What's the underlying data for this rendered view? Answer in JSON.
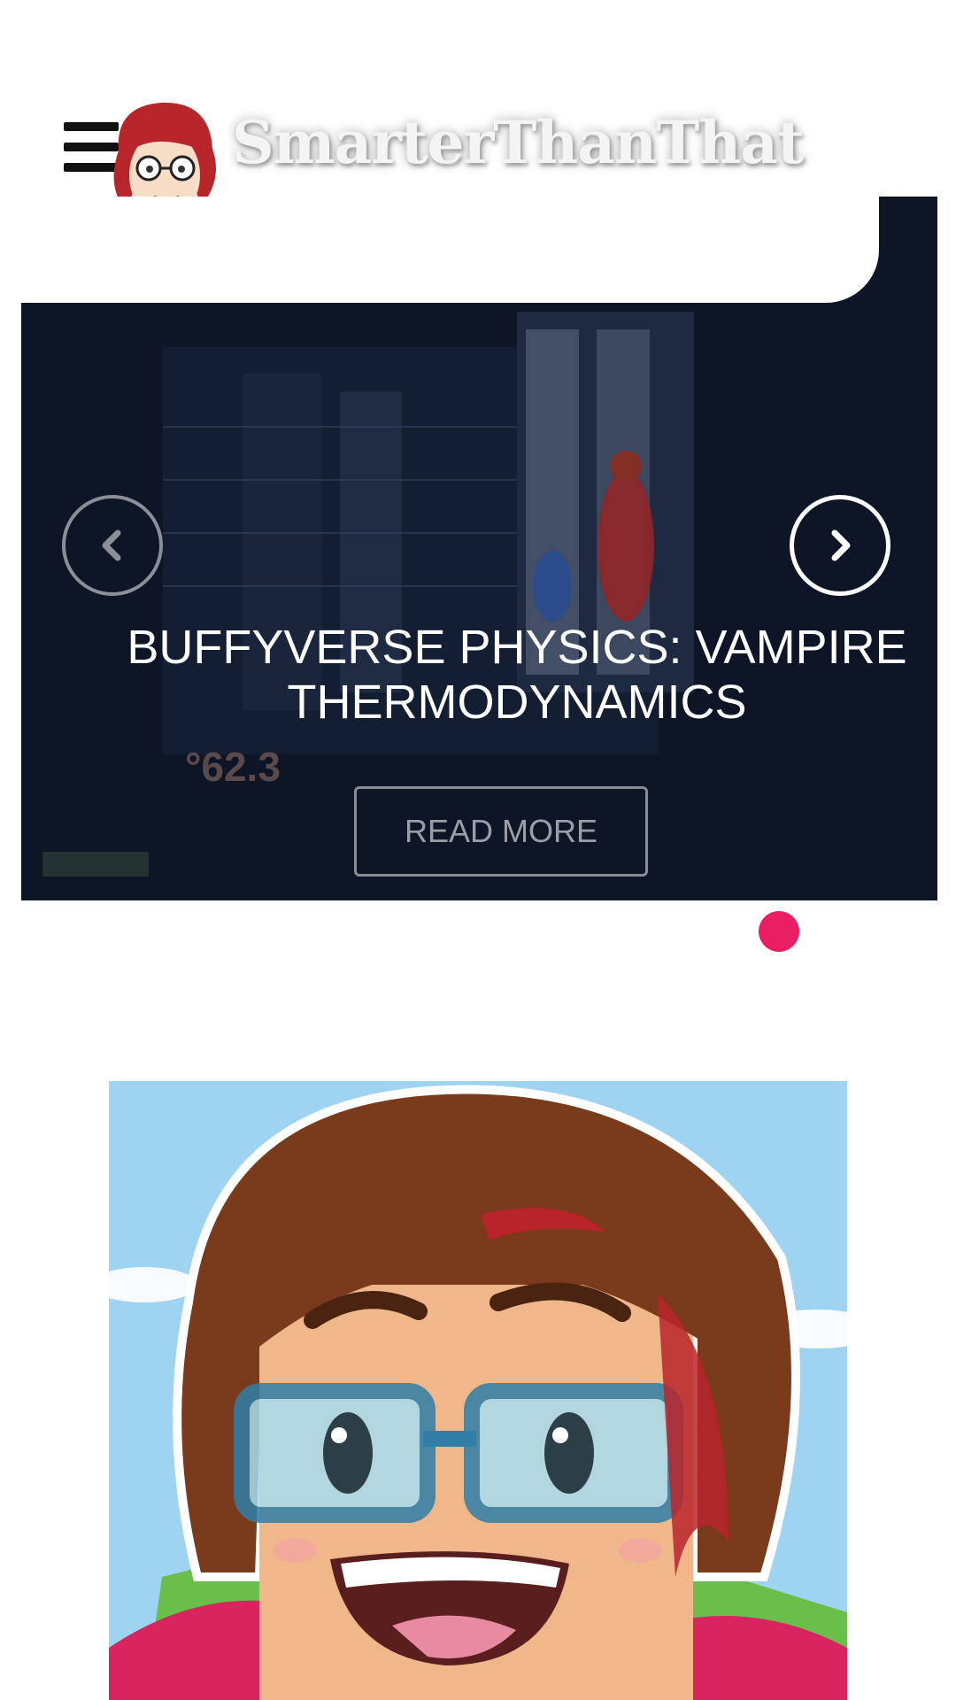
{
  "header": {
    "site_title": "SmarterThanThat",
    "menu_icon": "hamburger-menu-icon"
  },
  "slider": {
    "slide_title": "BUFFYVERSE PHYSICS: VAMPIRE THERMODYNAMICS",
    "read_more_label": "READ MORE",
    "overlay_reading": "°62.3",
    "prev_icon": "chevron-left-icon",
    "next_icon": "chevron-right-icon",
    "active_dot_color": "#e91e63"
  }
}
